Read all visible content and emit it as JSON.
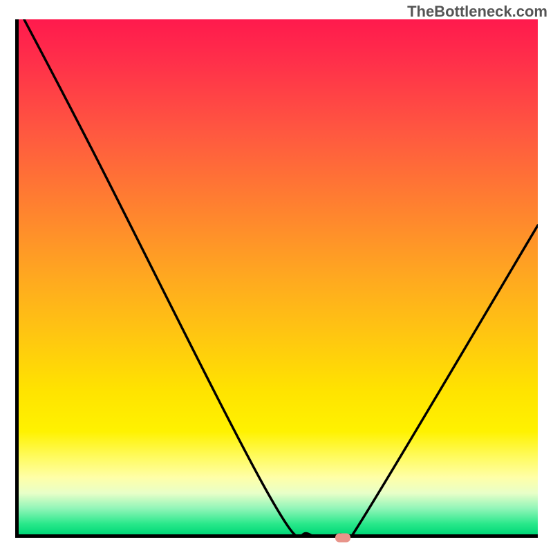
{
  "watermark": "TheBottleneck.com",
  "colors": {
    "curve": "#000000",
    "marker": "#e8948a",
    "axis": "#000000"
  },
  "chart_data": {
    "type": "line",
    "title": "",
    "xlabel": "",
    "ylabel": "",
    "xlim": [
      0,
      100
    ],
    "ylim": [
      0,
      100
    ],
    "x": [
      0,
      14,
      48,
      56,
      62,
      65,
      100
    ],
    "values": [
      102,
      75,
      8,
      0,
      0,
      1,
      60
    ],
    "marker": {
      "x": 62,
      "y": 0
    },
    "notes": "Values estimated from pixel positions; y is percentage of plot height from bottom. Curve starts above visible area (clipped)."
  }
}
